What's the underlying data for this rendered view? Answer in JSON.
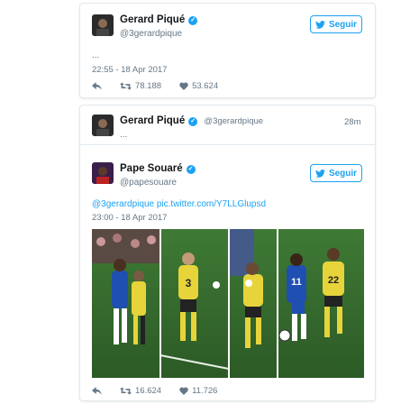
{
  "tweet1": {
    "name": "Gerard Piqué",
    "handle": "@3gerardpique",
    "follow_label": "Seguir",
    "body": "...",
    "timestamp": "22:55 - 18 Apr 2017",
    "retweets": "78.188",
    "likes": "53.624"
  },
  "tweet2": {
    "quoted": {
      "name": "Gerard Piqué",
      "handle": "@3gerardpique",
      "time": "28m",
      "body": "..."
    },
    "name": "Pape Souaré",
    "handle": "@papesouare",
    "follow_label": "Seguir",
    "mention": "@3gerardpique",
    "link": "pic.twitter.com/Y7LLGlupsd",
    "timestamp": "23:00 - 18 Apr 2017",
    "retweets": "16.624",
    "likes": "11.726"
  },
  "colors": {
    "accent": "#1da1f2",
    "muted": "#657786",
    "border": "#e1e8ed"
  },
  "icons": [
    "verified-icon",
    "twitter-bird-icon",
    "reply-icon",
    "retweet-icon",
    "heart-icon"
  ]
}
